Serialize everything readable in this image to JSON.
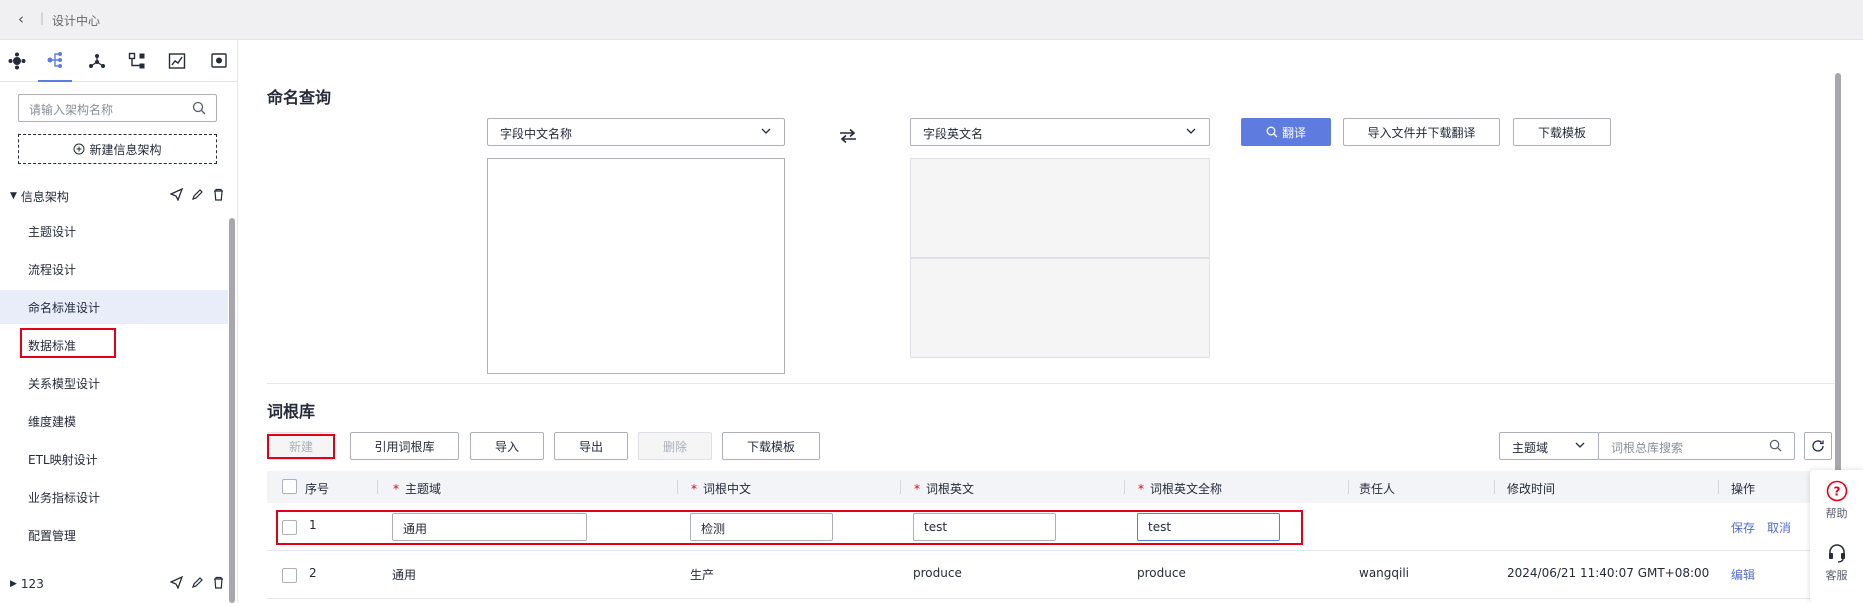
{
  "topbar": {
    "title": "设计中心"
  },
  "sidebar": {
    "search_placeholder": "请输入架构名称",
    "new_button": "新建信息架构",
    "root_label": "信息架构",
    "items": [
      "主题设计",
      "流程设计",
      "命名标准设计",
      "数据标准",
      "关系模型设计",
      "维度建模",
      "ETL映射设计",
      "业务指标设计",
      "配置管理"
    ],
    "second_root_label": "123"
  },
  "naming_query": {
    "title": "命名查询",
    "left_select": "字段中文名称",
    "right_select": "字段英文名",
    "translate_button": "翻译",
    "import_button": "导入文件并下载翻译",
    "download_button": "下载模板"
  },
  "root_library": {
    "title": "词根库",
    "toolbar": {
      "new": "新建",
      "quote": "引用词根库",
      "import": "导入",
      "export": "导出",
      "delete": "删除",
      "download": "下载模板"
    },
    "filter_select": "主题域",
    "search_placeholder": "词根总库搜索",
    "columns": [
      "序号",
      "主题域",
      "词根中文",
      "词根英文",
      "词根英文全称",
      "责任人",
      "修改时间",
      "操作"
    ],
    "edit_row": {
      "index": "1",
      "domain": "通用",
      "cn": "检测",
      "en": "test",
      "en_full": "test",
      "save": "保存",
      "cancel": "取消"
    },
    "rows": [
      {
        "index": "2",
        "domain": "通用",
        "cn": "生产",
        "en": "produce",
        "en_full": "produce",
        "owner": "wangqili",
        "modified": "2024/06/21 11:40:07 GMT+08:00",
        "action": "编辑"
      }
    ]
  },
  "float_panel": {
    "help": "帮助",
    "service": "客服"
  },
  "colors": {
    "primary": "#5e7ce0",
    "highlight": "#e0001a",
    "link": "#526ecc"
  }
}
